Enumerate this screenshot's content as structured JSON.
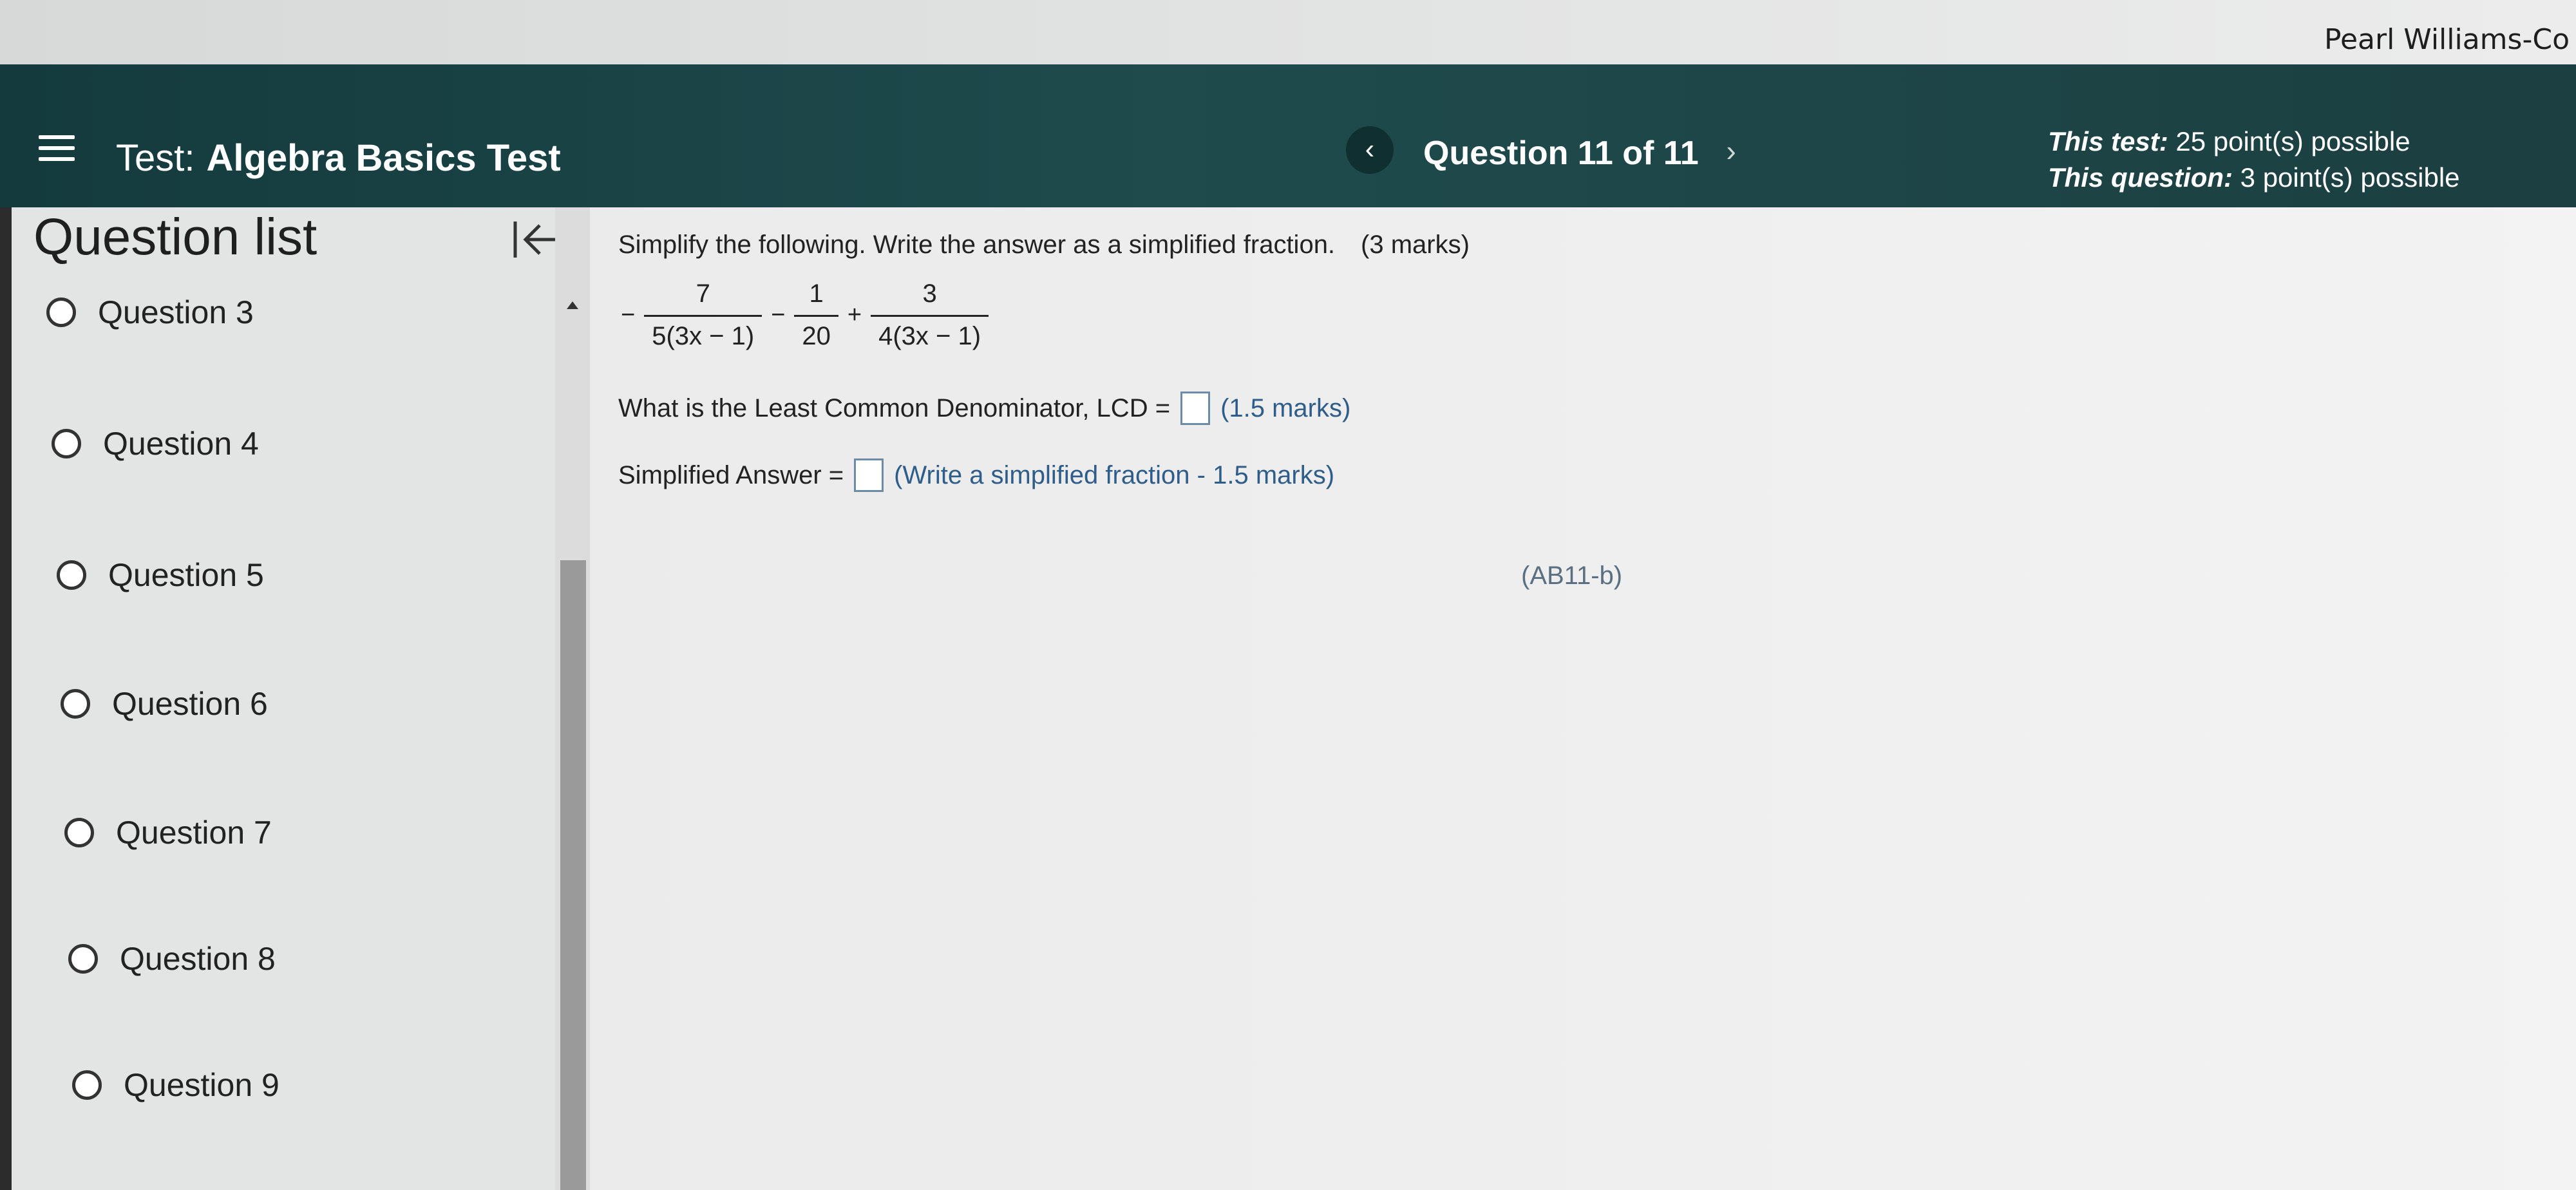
{
  "user": {
    "name": "Pearl Williams-Co"
  },
  "header": {
    "test_label": "Test:",
    "test_name": "Algebra Basics Test",
    "question_title": "Question 11 of 11",
    "points_test_label": "This test:",
    "points_test_value": "25 point(s) possible",
    "points_question_label": "This question:",
    "points_question_value": "3 point(s) possible"
  },
  "sidebar": {
    "title": "Question list",
    "items": [
      {
        "label": "Question 3"
      },
      {
        "label": "Question 4"
      },
      {
        "label": "Question 5"
      },
      {
        "label": "Question 6"
      },
      {
        "label": "Question 7"
      },
      {
        "label": "Question 8"
      },
      {
        "label": "Question 9"
      }
    ]
  },
  "question": {
    "instruction": "Simplify the following.  Write the answer as a simplified fraction.",
    "instruction_marks": "(3 marks)",
    "expression": {
      "sign": "−",
      "fractions": [
        {
          "num": "7",
          "den": "5(3x − 1)"
        },
        {
          "num": "1",
          "den": "20"
        },
        {
          "num": "3",
          "den": "4(3x − 1)"
        }
      ],
      "operators": [
        "−",
        "+"
      ]
    },
    "lcd_prompt": "What is the Least Common Denominator, LCD =",
    "lcd_hint": "(1.5 marks)",
    "answer_prompt": "Simplified Answer =",
    "answer_hint": "(Write a simplified fraction - 1.5 marks)",
    "code": "(AB11-b)"
  }
}
